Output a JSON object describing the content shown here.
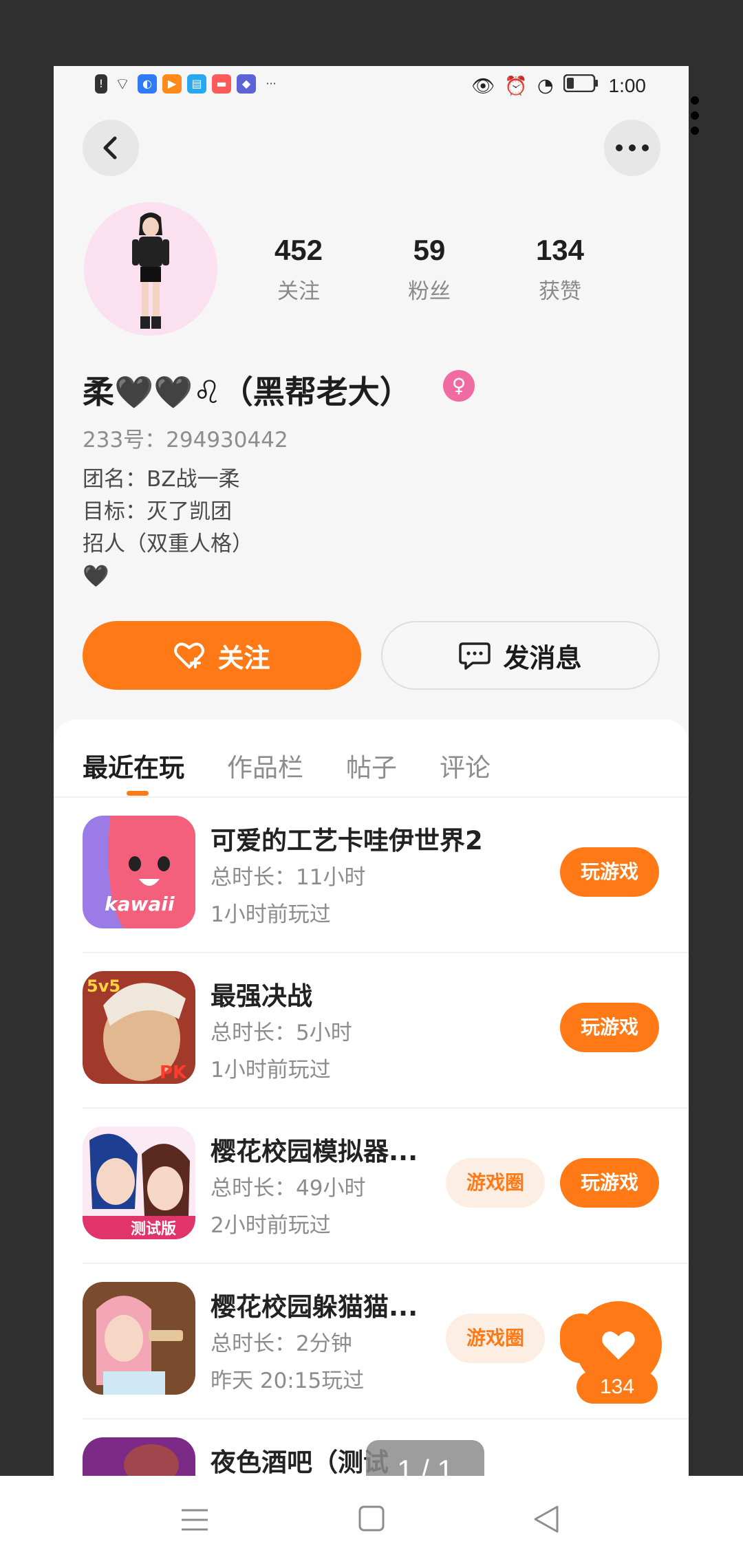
{
  "status_bar": {
    "time": "1:00",
    "more": "···"
  },
  "profile": {
    "following_count": "452",
    "following_label": "关注",
    "fans_count": "59",
    "fans_label": "粉丝",
    "likes_count": "134",
    "likes_label": "获赞",
    "name": "柔🖤🖤♌（黑帮老大）",
    "uid": "233号：294930442",
    "bio": [
      "团名：BZ战一柔",
      "目标：灭了凯团",
      "招人（双重人格）",
      "🖤"
    ]
  },
  "actions": {
    "follow": "关注",
    "message": "发消息"
  },
  "tabs": [
    "最近在玩",
    "作品栏",
    "帖子",
    "评论"
  ],
  "games": [
    {
      "title": "可爱的工艺卡哇伊世界2",
      "duration": "总时长：11小时",
      "last_played": "1小时前玩过",
      "icon_text": "kawaii",
      "play": "玩游戏"
    },
    {
      "title": "最强决战",
      "duration": "总时长：5小时",
      "last_played": "1小时前玩过",
      "icon_text": "5v5",
      "icon_text2": "PK",
      "play": "玩游戏"
    },
    {
      "title": "樱花校园模拟器...",
      "duration": "总时长：49小时",
      "last_played": "2小时前玩过",
      "icon_text": "测试版",
      "circle": "游戏圈",
      "play": "玩游戏"
    },
    {
      "title": "樱花校园躲猫猫...",
      "duration": "总时长：2分钟",
      "last_played": "昨天 20:15玩过",
      "circle": "游戏圈"
    },
    {
      "title": "夜色酒吧（测试"
    }
  ],
  "floating": {
    "likes": "134",
    "pager": "1 / 1"
  },
  "colors": {
    "accent": "#ff7a16",
    "background": "#f6f6f6"
  }
}
